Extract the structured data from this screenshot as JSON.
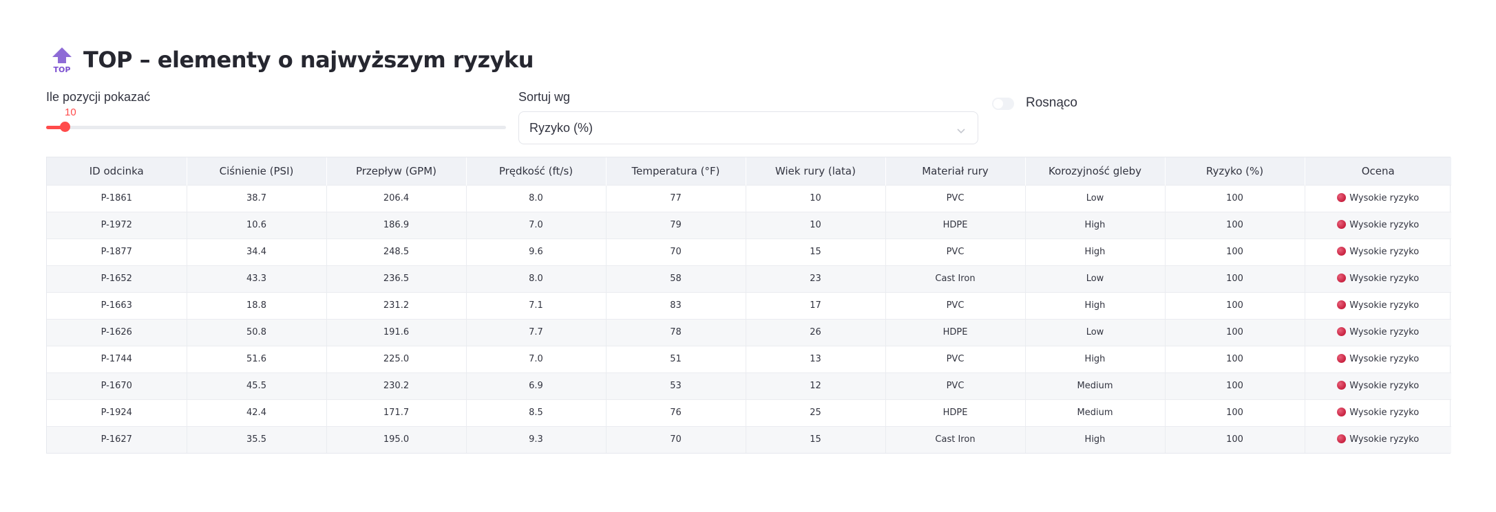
{
  "page": {
    "title": "TOP – elementy o najwyższym ryzyku",
    "icon": "top-arrow-icon",
    "icon_text": "TOP"
  },
  "controls": {
    "count_label": "Ile pozycji pokazać",
    "count_value": "10",
    "count_fraction": 0.04,
    "sort_label": "Sortuj wg",
    "sort_value": "Ryzyko (%)",
    "ascending_label": "Rosnąco",
    "ascending_checked": false,
    "accent_color": "#ff4b4b"
  },
  "table": {
    "columns": [
      "ID odcinka",
      "Ciśnienie (PSI)",
      "Przepływ (GPM)",
      "Prędkość (ft/s)",
      "Temperatura (°F)",
      "Wiek rury (lata)",
      "Materiał rury",
      "Korozyjność gleby",
      "Ryzyko (%)",
      "Ocena"
    ],
    "rows": [
      [
        "P-1861",
        "38.7",
        "206.4",
        "8.0",
        "77",
        "10",
        "PVC",
        "Low",
        "100",
        "Wysokie ryzyko"
      ],
      [
        "P-1972",
        "10.6",
        "186.9",
        "7.0",
        "79",
        "10",
        "HDPE",
        "High",
        "100",
        "Wysokie ryzyko"
      ],
      [
        "P-1877",
        "34.4",
        "248.5",
        "9.6",
        "70",
        "15",
        "PVC",
        "High",
        "100",
        "Wysokie ryzyko"
      ],
      [
        "P-1652",
        "43.3",
        "236.5",
        "8.0",
        "58",
        "23",
        "Cast Iron",
        "Low",
        "100",
        "Wysokie ryzyko"
      ],
      [
        "P-1663",
        "18.8",
        "231.2",
        "7.1",
        "83",
        "17",
        "PVC",
        "High",
        "100",
        "Wysokie ryzyko"
      ],
      [
        "P-1626",
        "50.8",
        "191.6",
        "7.7",
        "78",
        "26",
        "HDPE",
        "Low",
        "100",
        "Wysokie ryzyko"
      ],
      [
        "P-1744",
        "51.6",
        "225.0",
        "7.0",
        "51",
        "13",
        "PVC",
        "High",
        "100",
        "Wysokie ryzyko"
      ],
      [
        "P-1670",
        "45.5",
        "230.2",
        "6.9",
        "53",
        "12",
        "PVC",
        "Medium",
        "100",
        "Wysokie ryzyko"
      ],
      [
        "P-1924",
        "42.4",
        "171.7",
        "8.5",
        "76",
        "25",
        "HDPE",
        "Medium",
        "100",
        "Wysokie ryzyko"
      ],
      [
        "P-1627",
        "35.5",
        "195.0",
        "9.3",
        "70",
        "15",
        "Cast Iron",
        "High",
        "100",
        "Wysokie ryzyko"
      ]
    ],
    "status_color": "#d12b4a"
  }
}
